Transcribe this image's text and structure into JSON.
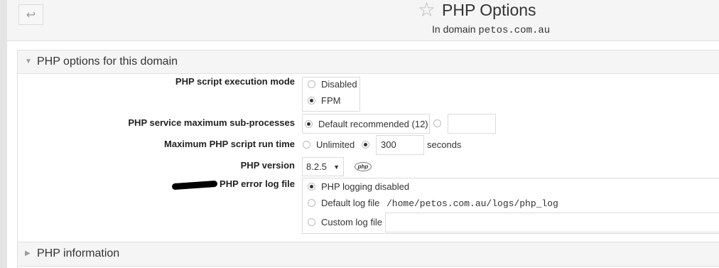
{
  "header": {
    "title": "PHP Options",
    "subtitle_prefix": "In domain",
    "domain": "petos.com.au",
    "back_glyph": "↩",
    "star_glyph": "☆"
  },
  "section_options": {
    "label": "PHP options for this domain",
    "caret": "▼"
  },
  "exec_mode": {
    "label": "PHP script execution mode",
    "options": [
      "Disabled",
      "FPM"
    ],
    "selected": "FPM"
  },
  "max_subprocesses": {
    "label": "PHP service maximum sub-processes",
    "default_option": "Default recommended (12)",
    "selected": "default",
    "custom_value": ""
  },
  "max_runtime": {
    "label": "Maximum PHP script run time",
    "unlimited_option": "Unlimited",
    "value": "300",
    "unit": "seconds",
    "selected": "value"
  },
  "php_version": {
    "label": "PHP version",
    "selected": "8.2.5",
    "arrow": "▼",
    "logo_text": "php"
  },
  "error_log": {
    "label": "PHP error log file",
    "options": {
      "disabled": "PHP logging disabled",
      "default": "Default log file",
      "custom": "Custom log file"
    },
    "default_path": "/home/petos.com.au/logs/php_log",
    "custom_value": "",
    "selected": "disabled"
  },
  "section_info": {
    "label": "PHP information",
    "caret": "▶"
  }
}
